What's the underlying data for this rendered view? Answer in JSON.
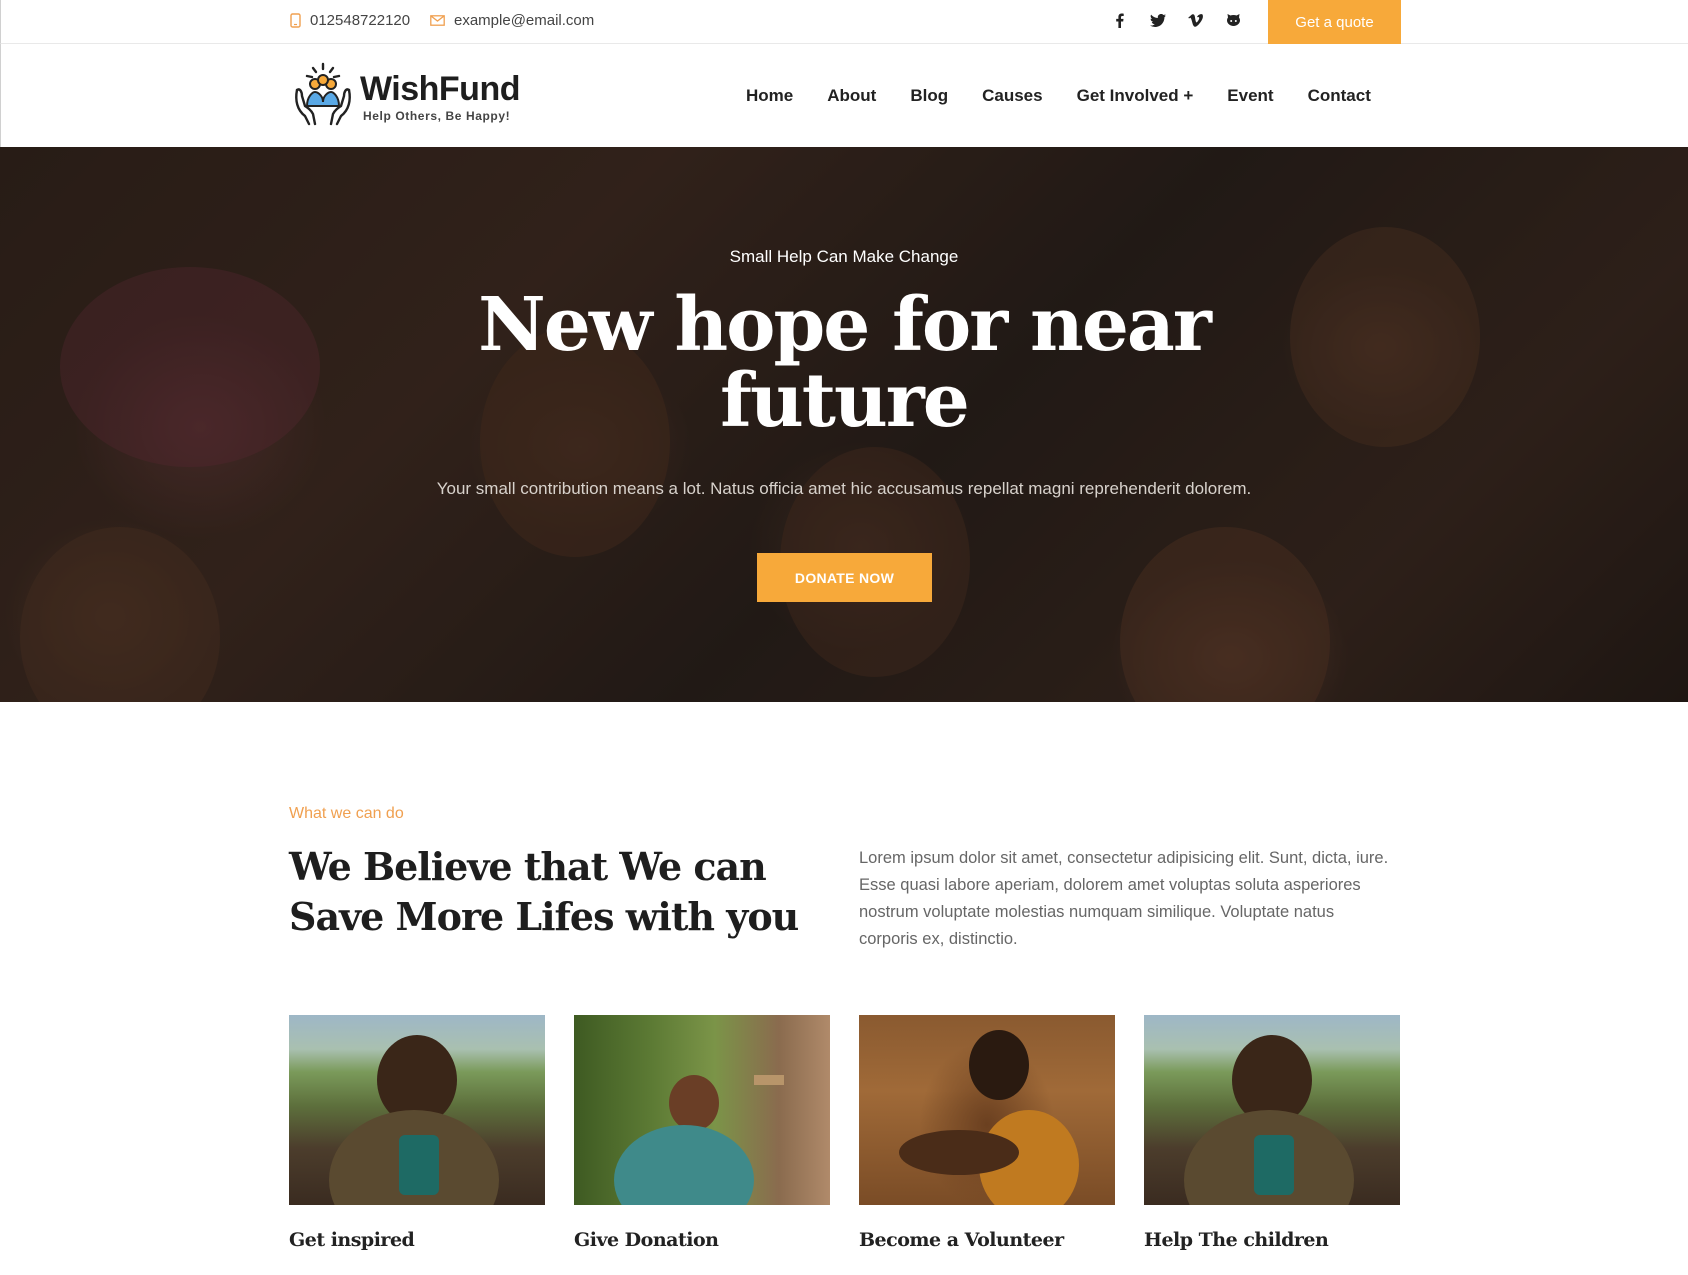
{
  "topbar": {
    "phone": "012548722120",
    "email": "example@email.com",
    "socials": [
      "facebook-icon",
      "twitter-icon",
      "vimeo-icon",
      "github-icon"
    ],
    "quote_button": "Get a quote"
  },
  "header": {
    "logo_name": "WishFund",
    "logo_tagline": "Help Others, Be Happy!",
    "nav": [
      "Home",
      "About",
      "Blog",
      "Causes",
      "Get Involved +",
      "Event",
      "Contact"
    ]
  },
  "hero": {
    "subtitle": "Small Help Can Make Change",
    "title": "New hope for near future",
    "text": "Your small contribution means a lot. Natus officia amet hic accusamus repellat magni reprehenderit dolorem.",
    "button": "DONATE NOW"
  },
  "about": {
    "eyebrow": "What we can do",
    "title": "We Believe that We can Save More Lifes with you",
    "text": "Lorem ipsum dolor sit amet, consectetur adipisicing elit. Sunt, dicta, iure. Esse quasi labore aperiam, dolorem amet voluptas soluta asperiores nostrum voluptate molestias numquam similique. Voluptate natus corporis ex, distinctio."
  },
  "cards": [
    {
      "label": "Get inspired"
    },
    {
      "label": "Give Donation"
    },
    {
      "label": "Become a Volunteer"
    },
    {
      "label": "Help The children"
    }
  ],
  "colors": {
    "accent": "#f7a93a",
    "eyebrow": "#f0a050",
    "heading": "#1e1e1e"
  }
}
